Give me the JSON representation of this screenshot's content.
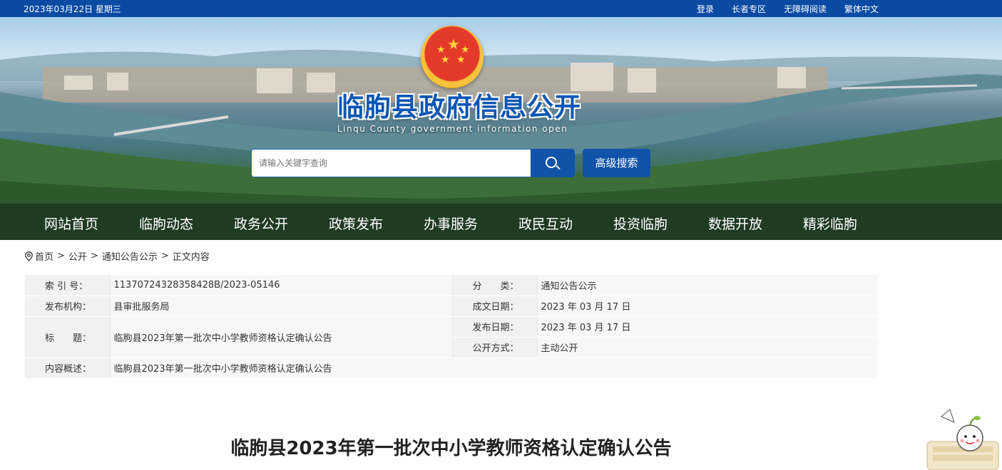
{
  "topbar": {
    "date": "2023年03月22日 星期三",
    "links": [
      "登录",
      "长者专区",
      "无障碍阅读",
      "繁体中文"
    ]
  },
  "header": {
    "title": "临朐县政府信息公开",
    "subtitle": "Linqu County government information open",
    "search_placeholder": "请输入关键字查询",
    "advanced_search": "高级搜索",
    "icons": {
      "emblem": "national-emblem",
      "search": "search-icon"
    }
  },
  "nav": {
    "items": [
      "网站首页",
      "临朐动态",
      "政务公开",
      "政策发布",
      "办事服务",
      "政民互动",
      "投资临朐",
      "数据开放",
      "精彩临朐"
    ]
  },
  "breadcrumb": {
    "icon": "location-pin-icon",
    "items": [
      "首页",
      "公开",
      "通知公告公示",
      "正文内容"
    ],
    "separator": ">"
  },
  "info": {
    "index_label": "索 引 号：",
    "index_value": "11370724328358428B/2023-05146",
    "category_label": "分　　类：",
    "category_value": "通知公告公示",
    "publisher_label": "发布机构：",
    "publisher_value": "县审批服务局",
    "created_label": "成文日期：",
    "created_value": "2023 年 03 月 17 日",
    "title_label": "标　　题：",
    "title_value": "临朐县2023年第一批次中小学教师资格认定确认公告",
    "published_label": "发布日期：",
    "published_value": "2023 年 03 月 17 日",
    "mode_label": "公开方式：",
    "mode_value": "主动公开",
    "summary_label": "内容概述：",
    "summary_value": "临朐县2023年第一批次中小学教师资格认定确认公告"
  },
  "article": {
    "title": "临朐县2023年第一批次中小学教师资格认定确认公告"
  },
  "colors": {
    "primary": "#0a4aa3",
    "button": "#1153a8",
    "title_blue": "#0b56b3"
  }
}
